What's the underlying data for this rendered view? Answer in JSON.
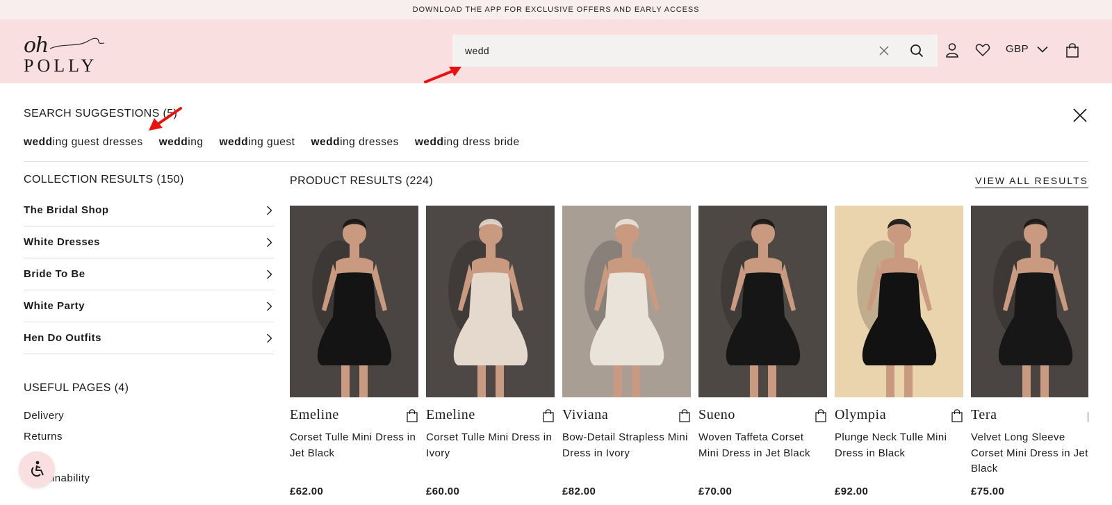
{
  "promo": {
    "text": "DOWNLOAD THE APP FOR EXCLUSIVE OFFERS AND EARLY ACCESS"
  },
  "header": {
    "logo_top": "oh",
    "logo_bottom": "POLLY",
    "search_value": "wedd",
    "currency": "GBP"
  },
  "suggestions": {
    "title": "SEARCH SUGGESTIONS (5)",
    "items": [
      {
        "bold": "wedd",
        "rest": "ing guest dresses"
      },
      {
        "bold": "wedd",
        "rest": "ing"
      },
      {
        "bold": "wedd",
        "rest": "ing guest"
      },
      {
        "bold": "wedd",
        "rest": "ing dresses"
      },
      {
        "bold": "wedd",
        "rest": "ing dress bride"
      }
    ]
  },
  "collections": {
    "title": "COLLECTION RESULTS (150)",
    "items": [
      "The Bridal Shop",
      "White Dresses",
      "Bride To Be",
      "White Party",
      "Hen Do Outfits"
    ]
  },
  "useful": {
    "title": "USEFUL PAGES (4)",
    "items": [
      "Delivery",
      "Returns",
      "",
      "Sustainability"
    ]
  },
  "products": {
    "title": "PRODUCT RESULTS (224)",
    "view_all": "VIEW ALL RESULTS",
    "items": [
      {
        "name": "Emeline",
        "desc": "Corset Tulle Mini Dress in Jet Black",
        "price": "£62.00",
        "bg": "#4a4542",
        "dress": "#141414"
      },
      {
        "name": "Emeline",
        "desc": "Corset Tulle Mini Dress in Ivory",
        "price": "£60.00",
        "bg": "#4d4845",
        "dress": "#e4d9cc"
      },
      {
        "name": "Viviana",
        "desc": "Bow-Detail Strapless Mini Dress in Ivory",
        "price": "£82.00",
        "bg": "#a89e94",
        "dress": "#e9e3da"
      },
      {
        "name": "Sueno",
        "desc": "Woven Taffeta Corset Mini Dress in Jet Black",
        "price": "£70.00",
        "bg": "#4e4845",
        "dress": "#161616"
      },
      {
        "name": "Olympia",
        "desc": "Plunge Neck Tulle Mini Dress in Black",
        "price": "£92.00",
        "bg": "#ead4ae",
        "dress": "#121212"
      },
      {
        "name": "Tera",
        "desc": "Velvet Long Sleeve Corset Mini Dress in Jet Black",
        "price": "£75.00",
        "bg": "#4a4542",
        "dress": "#171717"
      }
    ]
  },
  "colors": {
    "header_bg": "#f9dfe0",
    "promo_bg": "#f8eeee",
    "annotation_arrow": "#e8130f"
  }
}
